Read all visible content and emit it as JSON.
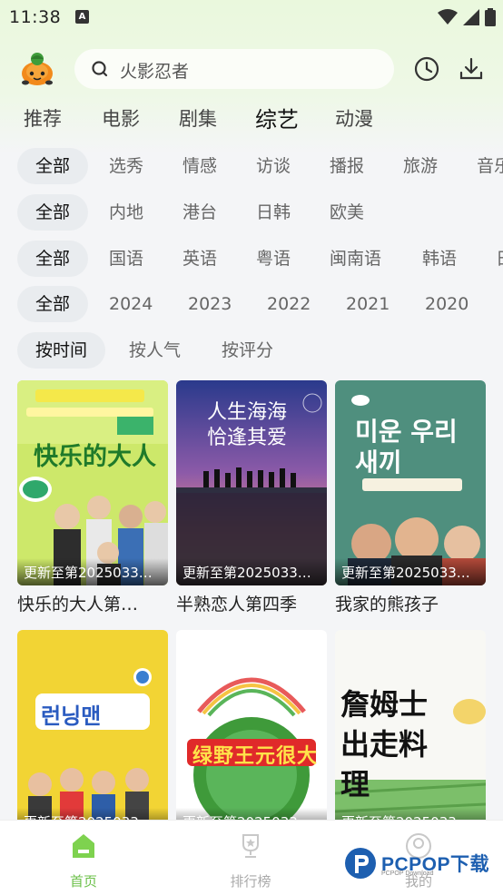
{
  "status_bar": {
    "time": "11:38",
    "notification_icon": "A"
  },
  "header": {
    "logo_icon": "turtle-mascot-icon",
    "search_placeholder": "火影忍者"
  },
  "tabs": [
    {
      "label": "推荐",
      "active": false
    },
    {
      "label": "电影",
      "active": false
    },
    {
      "label": "剧集",
      "active": false
    },
    {
      "label": "综艺",
      "active": true
    },
    {
      "label": "动漫",
      "active": false
    }
  ],
  "filters": {
    "type": [
      "全部",
      "选秀",
      "情感",
      "访谈",
      "播报",
      "旅游",
      "音乐"
    ],
    "region": [
      "全部",
      "内地",
      "港台",
      "日韩",
      "欧美"
    ],
    "language": [
      "全部",
      "国语",
      "英语",
      "粤语",
      "闽南语",
      "韩语",
      "日语"
    ],
    "year": [
      "全部",
      "2024",
      "2023",
      "2022",
      "2021",
      "2020"
    ],
    "sort": [
      "按时间",
      "按人气",
      "按评分"
    ]
  },
  "cards": [
    {
      "title": "快乐的大人第…",
      "update": "更新至第2025033…",
      "poster_text": "快乐的大人"
    },
    {
      "title": "半熟恋人第四季",
      "update": "更新至第2025033…",
      "poster_text": "人生海海 恰逢其爱"
    },
    {
      "title": "我家的熊孩子",
      "update": "更新至第2025033…",
      "poster_text": "미운 우리새끼"
    },
    {
      "title": "",
      "update": "更新至第2025033…",
      "poster_text": "런닝맨"
    },
    {
      "title": "",
      "update": "更新至第2025033…",
      "poster_text": "绿野王元很大"
    },
    {
      "title": "",
      "update": "更新至第2025033…",
      "poster_text": "詹姆士 出走料理"
    }
  ],
  "bottom_nav": [
    {
      "label": "首页",
      "active": true
    },
    {
      "label": "排行榜",
      "active": false
    },
    {
      "label": "我的",
      "active": false
    }
  ],
  "watermark": {
    "text": "PCPOP下载",
    "sub": "PCPOP Download"
  },
  "colors": {
    "accent": "#6cc04a",
    "header_bg": "#eaf8dd"
  }
}
